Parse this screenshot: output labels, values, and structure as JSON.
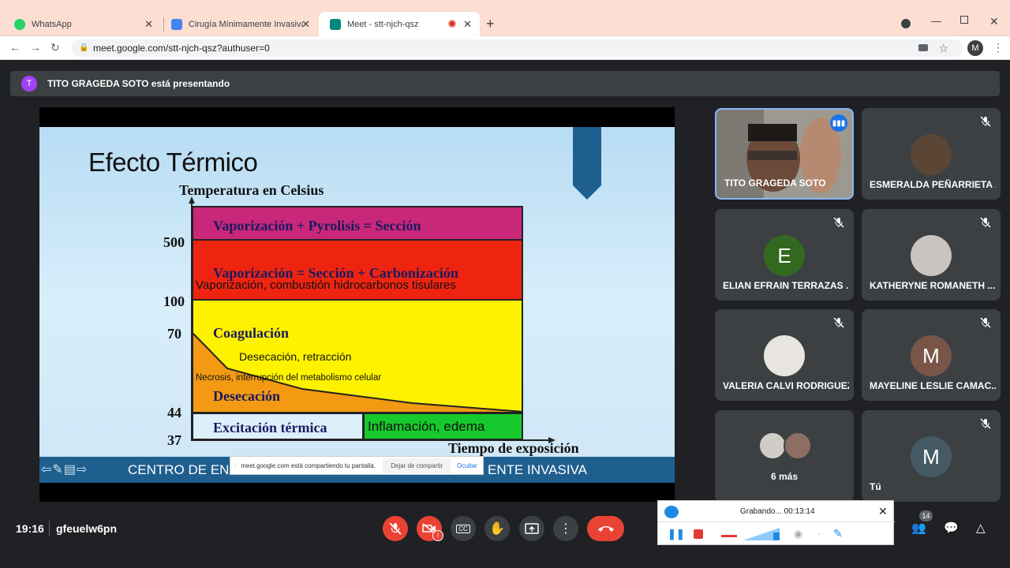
{
  "browser": {
    "tabs": [
      {
        "label": "WhatsApp",
        "color": "#25d366"
      },
      {
        "label": "Cirugía Mínimamente Invasiva Te",
        "color": "#4285f4"
      },
      {
        "label": "Meet - stt-njch-qsz",
        "color": "#00897b"
      }
    ],
    "url": "meet.google.com/stt-njch-qsz?authuser=0",
    "profile_initial": "M"
  },
  "meet": {
    "presenter_initial": "T",
    "presenting_text": "TITO GRAGEDA SOTO está presentando",
    "time": "19:16",
    "meeting_code": "gfeuelw6pn",
    "participant_count": "14",
    "more_people": "6 más",
    "participants": [
      {
        "name": "TITO GRAGEDA SOTO",
        "initial": "",
        "color": "#8a8a80"
      },
      {
        "name": "ESMERALDA PEÑARRIETA ...",
        "initial": "",
        "color": "#5b4636"
      },
      {
        "name": "ELIAN EFRAIN TERRAZAS ...",
        "initial": "E",
        "color": "#33691e"
      },
      {
        "name": "KATHERYNE ROMANETH ...",
        "initial": "",
        "color": "#c9c4c0"
      },
      {
        "name": "VALERIA CALVI RODRIGUEZ",
        "initial": "",
        "color": "#e8e4e0"
      },
      {
        "name": "MAYELINE LESLIE CAMAC...",
        "initial": "M",
        "color": "#795548"
      },
      {
        "name": "Tú",
        "initial": "M",
        "color": "#455a64"
      }
    ]
  },
  "share_notice": {
    "text": "meet.google.com está compartiendo tu pantalla.",
    "stop": "Dejar de compartir",
    "hide": "Ocultar"
  },
  "recorder": {
    "status": "Grabando... 00:13:14"
  },
  "slide": {
    "title": "Efecto Térmico",
    "y_axis_label": "Temperatura en Celsius",
    "x_axis_label": "Tiempo de exposición",
    "ticks": [
      "500",
      "100",
      "70",
      "44",
      "37"
    ],
    "zones": {
      "pyrolysis": "Vaporización + Pyrolisis  = Sección",
      "carbonization": "Vaporización = Sección + Carbonización",
      "carbonization_sub": "Vaporización, combustión  hidrocarbonos tisulares",
      "coagulation": "Coagulación",
      "coagulation_sub": "Desecación, retracción",
      "necrosis": "Necrosis, interrupción del metabolismo celular",
      "desiccation": "Desecación",
      "excitation": "Excitación térmica",
      "inflammation": "Inflamación, edema"
    },
    "footer_left": "CENTRO DE EN",
    "footer_right": "ENTE INVASIVA"
  }
}
